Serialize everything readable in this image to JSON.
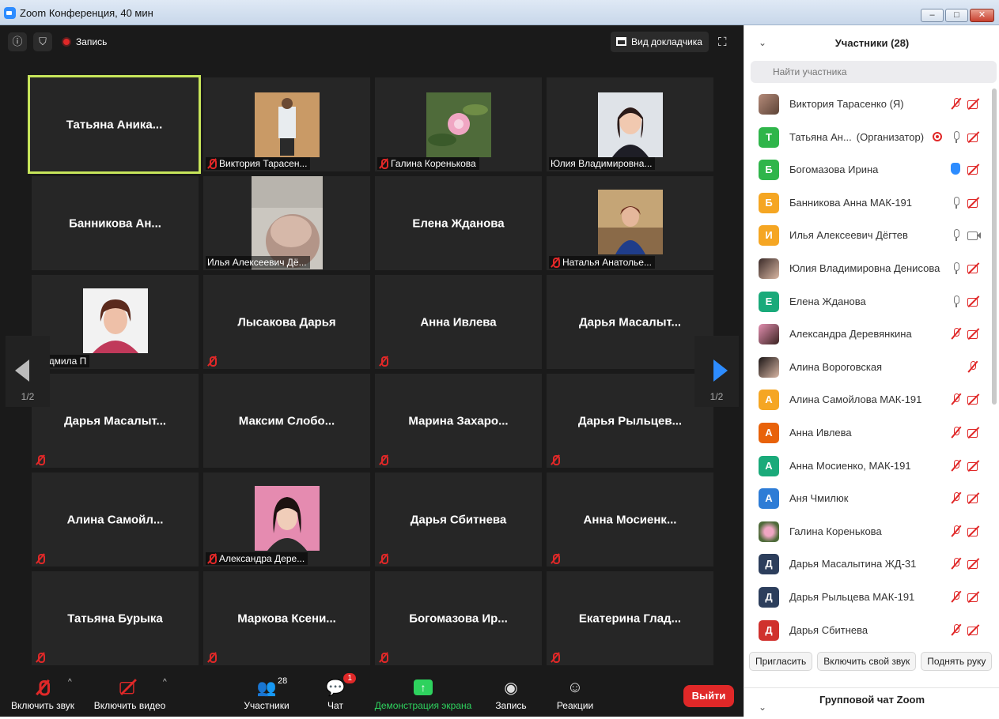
{
  "window": {
    "title": "Zoom Конференция, 40 мин",
    "controls": [
      "–",
      "□",
      "✕"
    ]
  },
  "topbar": {
    "recording_label": "Запись",
    "speaker_view_label": "Вид докладчика"
  },
  "gallery": {
    "page_indicator": "1/2",
    "tiles": [
      {
        "name": "Татьяна Аника...",
        "kind": "name",
        "active": true
      },
      {
        "name": "Виктория Тарасен...",
        "kind": "photo",
        "muted": true
      },
      {
        "name": "Галина Коренькова",
        "kind": "photo",
        "muted": true
      },
      {
        "name": "Юлия Владимировна...",
        "kind": "photo",
        "muted": false
      },
      {
        "name": "Банникова Ан...",
        "kind": "name",
        "speaking": true
      },
      {
        "name": "Илья Алексеевич Дё...",
        "kind": "video",
        "muted": false
      },
      {
        "name": "Елена Жданова",
        "kind": "name"
      },
      {
        "name": "Наталья Анатолье...",
        "kind": "photo",
        "muted": true
      },
      {
        "name": "Людмила П",
        "kind": "photo",
        "muted": false
      },
      {
        "name": "Лысакова Дарья",
        "kind": "name",
        "muted": true
      },
      {
        "name": "Анна Ивлева",
        "kind": "name",
        "muted": true
      },
      {
        "name": "Дарья Масалыт...",
        "kind": "name"
      },
      {
        "name": "Дарья Масалыт...",
        "kind": "name",
        "muted": true
      },
      {
        "name": "Максим Слобо...",
        "kind": "name"
      },
      {
        "name": "Марина Захаро...",
        "kind": "name",
        "muted": true
      },
      {
        "name": "Дарья Рыльцев...",
        "kind": "name",
        "muted": true
      },
      {
        "name": "Алина Самойл...",
        "kind": "name",
        "muted": true
      },
      {
        "name": "Александра Дере...",
        "kind": "photo",
        "muted": true
      },
      {
        "name": "Дарья Сбитнева",
        "kind": "name",
        "muted": true
      },
      {
        "name": "Анна Мосиенк...",
        "kind": "name",
        "muted": true
      },
      {
        "name": "Татьяна Бурыка",
        "kind": "name",
        "muted": true
      },
      {
        "name": "Маркова Ксени...",
        "kind": "name",
        "muted": true
      },
      {
        "name": "Богомазова Ир...",
        "kind": "name",
        "muted": true
      },
      {
        "name": "Екатерина Глад...",
        "kind": "name",
        "muted": true
      }
    ]
  },
  "toolbar": {
    "unmute_label": "Включить звук",
    "video_label": "Включить видео",
    "participants_label": "Участники",
    "participants_count": "28",
    "chat_label": "Чат",
    "chat_badge": "1",
    "share_label": "Демонстрация экрана",
    "record_label": "Запись",
    "reactions_label": "Реакции",
    "end_label": "Выйти"
  },
  "panel": {
    "title": "Участники (28)",
    "search_placeholder": "Найти участника",
    "participants": [
      {
        "name": "Виктория Тарасенко (Я)",
        "avatar": "photo",
        "mic": "off",
        "cam": "off"
      },
      {
        "name": "Татьяна Ан...",
        "role": "(Организатор)",
        "avatar_letter": "Т",
        "color": "#2fb54a",
        "recording": true,
        "mic": "on",
        "cam": "off"
      },
      {
        "name": "Богомазова Ирина",
        "avatar_letter": "Б",
        "color": "#2fb54a",
        "hand": true,
        "cam": "off"
      },
      {
        "name": "Банникова Анна МАК-191",
        "avatar_letter": "Б",
        "color": "#f5a623",
        "mic": "on",
        "cam": "off"
      },
      {
        "name": "Илья Алексеевич Дёгтев",
        "avatar_letter": "И",
        "color": "#f5a623",
        "mic": "on",
        "cam": "on"
      },
      {
        "name": "Юлия Владимировна Денисова",
        "avatar": "photo",
        "mic": "on",
        "cam": "off"
      },
      {
        "name": "Елена Жданова",
        "avatar_letter": "Е",
        "color": "#1aaa7a",
        "mic": "on",
        "cam": "off"
      },
      {
        "name": "Александра Деревянкина",
        "avatar": "photo",
        "mic": "off",
        "cam": "off"
      },
      {
        "name": "Алина Вороговская",
        "avatar": "photo",
        "mic": "off"
      },
      {
        "name": "Алина Самойлова МАК-191",
        "avatar_letter": "А",
        "color": "#f5a623",
        "mic": "off",
        "cam": "off"
      },
      {
        "name": "Анна Ивлева",
        "avatar_letter": "А",
        "color": "#e8620a",
        "mic": "off",
        "cam": "off"
      },
      {
        "name": "Анна Мосиенко, МАК-191",
        "avatar_letter": "А",
        "color": "#1aaa7a",
        "mic": "off",
        "cam": "off"
      },
      {
        "name": "Аня Чмилюк",
        "avatar_letter": "А",
        "color": "#2d7cd6",
        "mic": "off",
        "cam": "off"
      },
      {
        "name": "Галина Коренькова",
        "avatar": "photo",
        "mic": "off",
        "cam": "off"
      },
      {
        "name": "Дарья Масалытина ЖД-31",
        "avatar_letter": "Д",
        "color": "#2c3e5c",
        "mic": "off",
        "cam": "off"
      },
      {
        "name": "Дарья Рыльцева МАК-191",
        "avatar_letter": "Д",
        "color": "#2c3e5c",
        "mic": "off",
        "cam": "off"
      },
      {
        "name": "Дарья Сбитнева",
        "avatar_letter": "Д",
        "color": "#d0312d",
        "mic": "off",
        "cam": "off"
      }
    ],
    "buttons": {
      "invite": "Пригласить",
      "unmute_me": "Включить свой звук",
      "raise_hand": "Поднять руку"
    },
    "chat_title": "Групповой чат Zoom"
  }
}
